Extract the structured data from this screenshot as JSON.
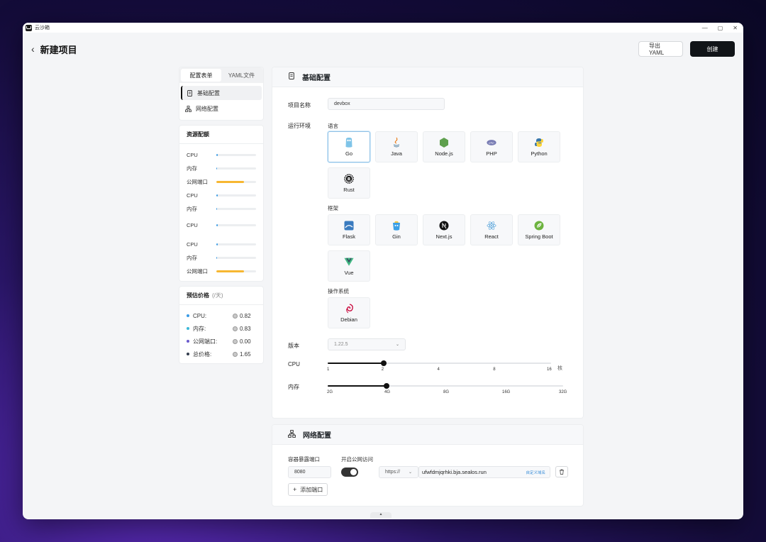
{
  "window": {
    "app_title": "云沙箱",
    "controls": [
      "—",
      "▢",
      "✕"
    ]
  },
  "header": {
    "back_icon": "chevron-left-icon",
    "title": "新建项目",
    "export_label": "导出YAML",
    "create_label": "创建"
  },
  "left": {
    "tabs": [
      {
        "label": "配置表单",
        "active": true
      },
      {
        "label": "YAML文件",
        "active": false
      }
    ],
    "nav": [
      {
        "label": "基础配置",
        "icon": "document-icon",
        "active": true
      },
      {
        "label": "网络配置",
        "icon": "network-icon",
        "active": false
      }
    ],
    "resources": {
      "title": "资源配额",
      "rows": [
        {
          "label": "CPU",
          "fill": 0.03,
          "color": "#3b9ce6"
        },
        {
          "label": "内存",
          "fill": 0.01,
          "color": "#3b9ce6"
        },
        {
          "label": "公网端口",
          "fill": 0.7,
          "color": "#f7b731"
        },
        {
          "label": "CPU",
          "fill": 0.03,
          "color": "#3b9ce6"
        },
        {
          "label": "内存",
          "fill": 0.01,
          "color": "#3b9ce6"
        },
        {
          "label": "CPU",
          "fill": 0.03,
          "color": "#3b9ce6"
        },
        {
          "label": "CPU",
          "fill": 0.03,
          "color": "#3b9ce6"
        },
        {
          "label": "内存",
          "fill": 0.01,
          "color": "#3b9ce6"
        },
        {
          "label": "公网端口",
          "fill": 0.7,
          "color": "#f7b731"
        }
      ]
    },
    "price": {
      "title": "预估价格",
      "unit": "(/天)",
      "rows": [
        {
          "label": "CPU:",
          "value": "0.82",
          "color": "#3b9ce6"
        },
        {
          "label": "内存:",
          "value": "0.83",
          "color": "#3bb8d8"
        },
        {
          "label": "公网端口:",
          "value": "0.00",
          "color": "#6a5acd"
        },
        {
          "label": "总价格:",
          "value": "1.65",
          "color": "#333d4d"
        }
      ]
    }
  },
  "basic": {
    "title": "基础配置",
    "name_label": "项目名称",
    "name_value": "devbox",
    "runtime_label": "运行环境",
    "language_label": "语言",
    "languages": [
      "Go",
      "Java",
      "Node.js",
      "PHP",
      "Python",
      "Rust"
    ],
    "framework_label": "框架",
    "frameworks": [
      "Flask",
      "Gin",
      "Next.js",
      "React",
      "Spring Boot",
      "Vue"
    ],
    "os_label": "操作系统",
    "os": [
      "Debian"
    ],
    "selected": "Go",
    "version_label": "版本",
    "version_value": "1.22.5",
    "cpu_label": "CPU",
    "cpu_ticks": [
      "1",
      "2",
      "4",
      "8",
      "16"
    ],
    "cpu_unit": "核",
    "cpu_value_index": 1,
    "mem_label": "内存",
    "mem_ticks": [
      "2G",
      "4G",
      "8G",
      "16G",
      "32G"
    ],
    "mem_value_index": 1
  },
  "network": {
    "title": "网络配置",
    "port_label": "容器暴露端口",
    "public_label": "开启公网访问",
    "port_value": "8080",
    "public_enabled": true,
    "protocol": "https://",
    "domain": "ufwfdmjqrhki.bja.sealos.run",
    "custom_domain_label": "自定义域名",
    "add_port_label": "添加端口"
  }
}
